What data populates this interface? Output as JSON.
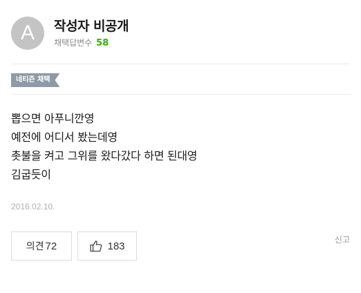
{
  "author": {
    "avatar_letter": "A",
    "name": "작성자 비공개",
    "stat_label": "채택답변수",
    "stat_value": "58"
  },
  "badge": {
    "label": "네티즌 채택"
  },
  "answer": {
    "lines": [
      "뽑으면 아푸니깐영",
      "예전에 어디서 봤는데영",
      "촛불을 켜고 그위를 왔다갔다 하면 된대영",
      "김굽듯이"
    ],
    "date": "2016.02.10."
  },
  "actions": {
    "comment_label": "의견",
    "comment_count": "72",
    "like_count": "183",
    "report_label": "신고"
  },
  "colors": {
    "accent_green": "#2db400",
    "badge_bg": "#8f9aa8",
    "avatar_bg": "#c4c4c4"
  },
  "icons": {
    "like": "thumbs-up-outline-icon"
  }
}
